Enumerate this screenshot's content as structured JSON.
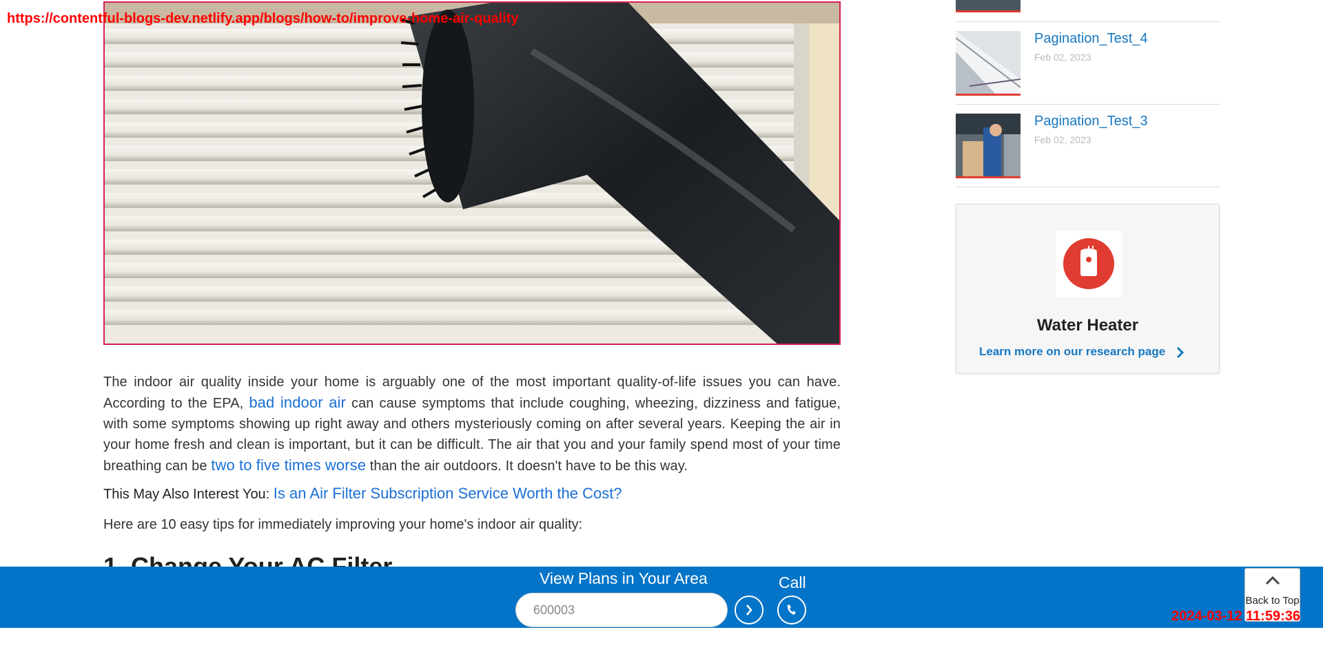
{
  "overlay": {
    "url": "https://contentful-blogs-dev.netlify.app/blogs/how-to/improve-home-air-quality",
    "timestamp": "2024-03-12 11:59:36"
  },
  "article": {
    "p1_a": "The indoor air quality inside your home is arguably one of the most important quality-of-life issues you can have. According to the EPA, ",
    "p1_link1": "bad indoor air",
    "p1_b": " can cause symptoms that include coughing, wheezing, dizziness and fatigue, with some symptoms showing up right away and others mysteriously coming on after several years. Keeping the air in your home fresh and clean is important, but it can be difficult. The air that you and your family spend most of your time breathing can be ",
    "p1_link2": "two to five times worse",
    "p1_c": " than the air outdoors. It doesn't have to be this way.",
    "interest_label": "This May Also Interest You: ",
    "interest_link": "Is an Air Filter Subscription Service Worth the Cost?",
    "tips_intro": "Here are 10 easy tips for immediately improving your home's indoor air quality:",
    "heading1": "1. Change Your AC Filter"
  },
  "sidebar": {
    "posts": [
      {
        "title": "Pagination_Test_4",
        "date": "Feb 02, 2023"
      },
      {
        "title": "Pagination_Test_3",
        "date": "Feb 02, 2023"
      }
    ],
    "card": {
      "icon": "water-heater-icon",
      "title": "Water Heater",
      "link_text": "Learn more on our research page"
    }
  },
  "cta": {
    "label": "View Plans in Your Area",
    "zip_placeholder": "600003",
    "call_label": "Call",
    "back_to_top": "Back to Top"
  },
  "colors": {
    "accent_blue": "#0474c8",
    "link_blue": "#1a6fd6",
    "brand_red": "#e03c31"
  }
}
